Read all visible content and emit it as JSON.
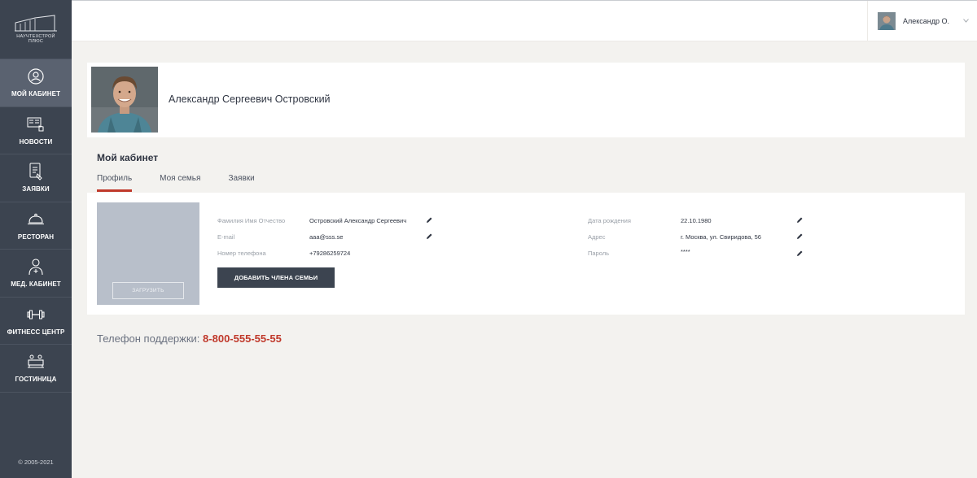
{
  "logo": {
    "line1": "НАУЧТЕХСТРОЙ",
    "line2": "ПЛЮС"
  },
  "sidebar": {
    "items": [
      {
        "label": "МОЙ КАБИНЕТ",
        "icon": "user-circle-icon",
        "active": true
      },
      {
        "label": "НОВОСТИ",
        "icon": "newspaper-icon",
        "active": false
      },
      {
        "label": "ЗАЯВКИ",
        "icon": "tablet-request-icon",
        "active": false
      },
      {
        "label": "РЕСТОРАН",
        "icon": "cloche-icon",
        "active": false
      },
      {
        "label": "МЕД. КАБИНЕТ",
        "icon": "doctor-icon",
        "active": false
      },
      {
        "label": "ФИТНЕСС ЦЕНТР",
        "icon": "dumbbell-icon",
        "active": false
      },
      {
        "label": "ГОСТИНИЦА",
        "icon": "hotel-icon",
        "active": false
      }
    ],
    "copyright": "© 2005-2021"
  },
  "header": {
    "user_name": "Александр О."
  },
  "profile": {
    "full_name": "Александр Сергеевич Островский"
  },
  "page": {
    "title": "Мой кабинет",
    "tabs": [
      {
        "label": "Профиль",
        "active": true
      },
      {
        "label": "Моя семья",
        "active": false
      },
      {
        "label": "Заявки",
        "active": false
      }
    ]
  },
  "card": {
    "upload_label": "ЗАГРУЗИТЬ",
    "add_member_label": "ДОБАВИТЬ ЧЛЕНА СЕМЬИ",
    "left_fields": [
      {
        "label": "Фамилия Имя Отчество",
        "value": "Островский Александр Сергеевич",
        "editable": true
      },
      {
        "label": "E-mail",
        "value": "aaa@sss.se",
        "editable": true
      },
      {
        "label": "Номер телефона",
        "value": "+79286259724",
        "editable": false
      }
    ],
    "right_fields": [
      {
        "label": "Дата рождения",
        "value": "22.10.1980",
        "editable": true
      },
      {
        "label": "Адрес",
        "value": "г. Москва, ул. Свиридова, 56",
        "editable": true
      },
      {
        "label": "Пароль",
        "value": "****",
        "editable": true
      }
    ]
  },
  "support": {
    "label": "Телефон поддержки:",
    "phone": "8-800-555-55-55"
  },
  "colors": {
    "sidebar": "#3c4450",
    "accent": "#c0392b",
    "background": "#f3f2ef"
  }
}
